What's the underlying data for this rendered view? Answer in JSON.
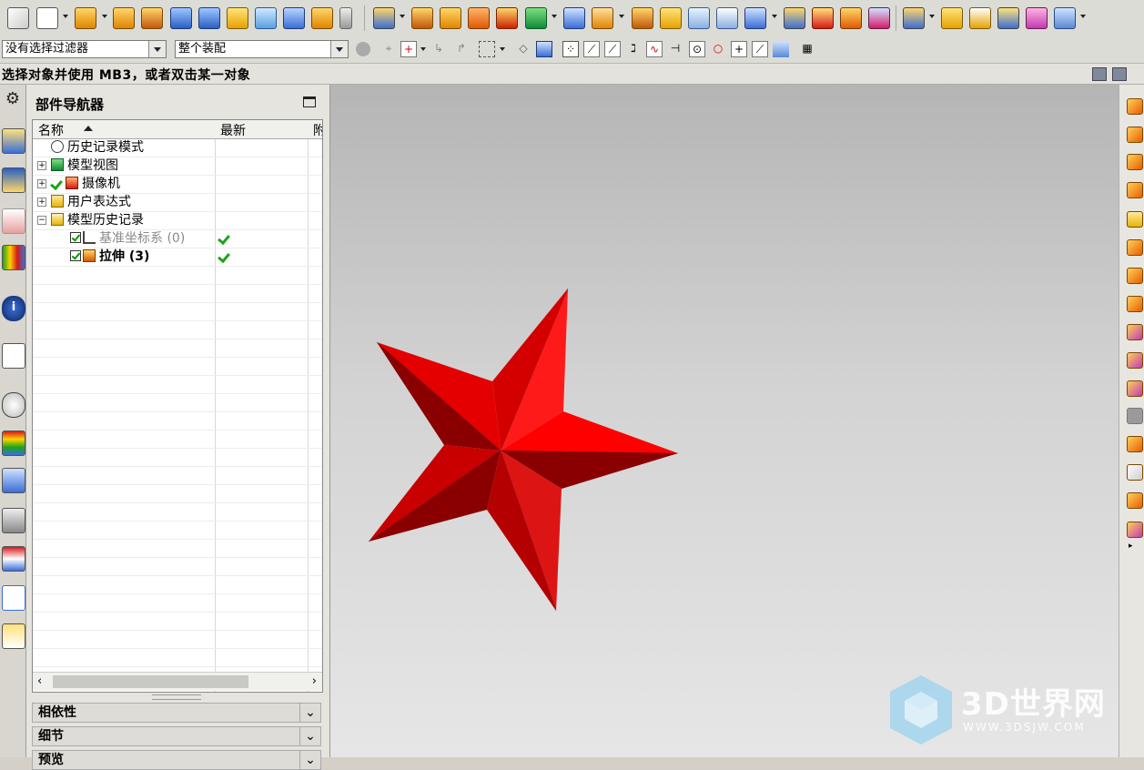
{
  "toolbar_row2": {
    "selection_filter": "没有选择过滤器",
    "scope": "整个装配"
  },
  "status_bar": {
    "prompt": "选择对象并使用 MB3，或者双击某一对象"
  },
  "part_navigator": {
    "title": "部件导航器",
    "columns": {
      "name": "名称",
      "latest": "最新",
      "third": "附"
    },
    "nodes": [
      {
        "label": "历史记录模式",
        "icon": "clock-icon"
      },
      {
        "label": "模型视图",
        "icon": "model-views-icon"
      },
      {
        "label": "摄像机",
        "icon": "camera-icon"
      },
      {
        "label": "用户表达式",
        "icon": "folder-icon"
      },
      {
        "label": "模型历史记录",
        "icon": "folder-open-icon"
      },
      {
        "label": "基准坐标系 (0)",
        "icon": "datum-csys-icon",
        "checked": true,
        "up_to_date": true
      },
      {
        "label": "拉伸 (3)",
        "icon": "extrude-icon",
        "checked": true,
        "up_to_date": true
      }
    ],
    "sections": {
      "dependencies": "相依性",
      "details": "细节",
      "preview": "预览"
    }
  },
  "viewport": {
    "model": "five-pointed-star-solid",
    "star_colors": {
      "light": "#ff0000",
      "mid": "#d40000",
      "dark": "#8a0000"
    }
  },
  "watermark": {
    "brand": "3D世界网",
    "url": "WWW.3DSJW.COM"
  },
  "colors": {
    "toolbar_bg": "#dcdcd6",
    "panel_bg": "#e6e4de",
    "accent_red": "#e10000"
  }
}
